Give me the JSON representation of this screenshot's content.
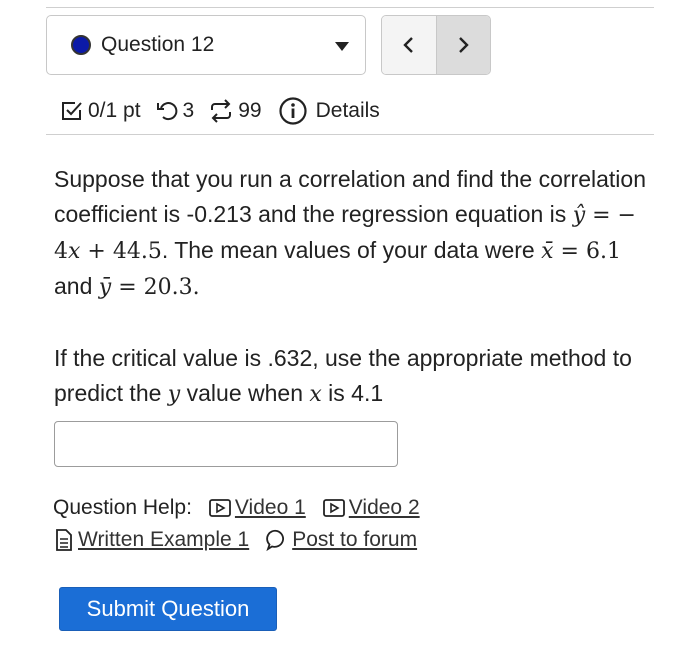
{
  "question_selector": {
    "label": "Question 12",
    "status_color": "#0b1aa8"
  },
  "nav": {
    "prev_symbol": "<",
    "next_symbol": ">"
  },
  "meta": {
    "score": "0/1 pt",
    "retries": "3",
    "attempts": "99",
    "details_label": "Details"
  },
  "question": {
    "p1_a": "Suppose that you run a correlation and find the correlation coefficient is -0.213 and the regression equation is ",
    "yhat": "ŷ",
    "eq_rhs": " = − 4",
    "x_var": "x",
    "eq_const": " + 44.5",
    "p1_b": ". The mean values of your data were ",
    "xbar": "x̄",
    "xbar_val": " = 6.1",
    "and": " and ",
    "ybar": "ȳ",
    "ybar_val": " = 20.3",
    "end": ".",
    "p2_a": "If the critical value is .632, use the appropriate method to predict the ",
    "y_var": "y",
    "p2_b": " value when ",
    "x_var2": "x",
    "p2_c": " is 4.1"
  },
  "answer": {
    "value": ""
  },
  "help": {
    "label": "Question Help:",
    "video1": "Video 1",
    "video2": "Video 2",
    "written_example": "Written Example 1",
    "forum": "Post to forum"
  },
  "submit": {
    "label": "Submit Question",
    "color": "#1b6ed6"
  }
}
